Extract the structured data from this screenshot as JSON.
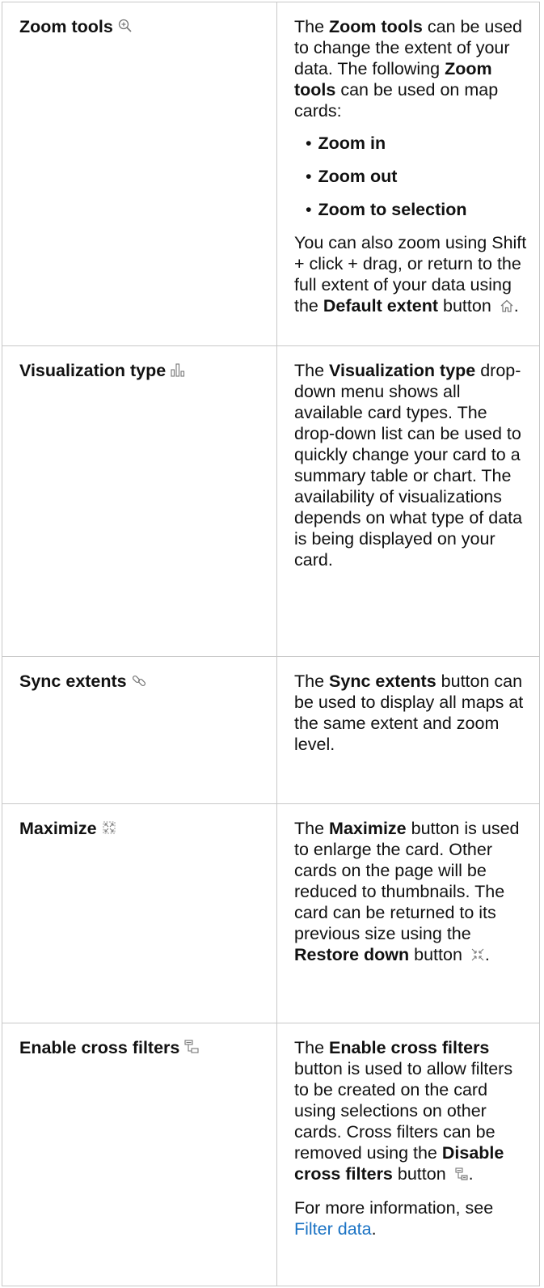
{
  "rows": [
    {
      "tool": "Zoom tools",
      "icon": "zoom-in-icon",
      "desc_intro": [
        "The ",
        "Zoom tools",
        " can be used to change the extent of your data. The following ",
        "Zoom tools",
        " can be used on map cards:"
      ],
      "bullets": [
        "Zoom in",
        "Zoom out",
        "Zoom to selection"
      ],
      "desc_outro": [
        "You can also zoom using Shift + click + drag, or return to the full extent of your data using the ",
        "Default extent",
        " button ",
        "."
      ]
    },
    {
      "tool": "Visualization type",
      "icon": "bar-chart-icon",
      "desc": [
        "The ",
        "Visualization type",
        " drop-down menu shows all available card types. The drop-down list can be used to quickly change your card to a summary table or chart. The availability of visualizations depends on what type of data is being displayed on your card."
      ]
    },
    {
      "tool": "Sync extents",
      "icon": "link-icon",
      "desc": [
        "The ",
        "Sync extents",
        " button can be used to display all maps at the same extent and zoom level."
      ]
    },
    {
      "tool": "Maximize",
      "icon": "maximize-icon",
      "desc": [
        "The ",
        "Maximize",
        " button is used to enlarge the card. Other cards on the page will be reduced to thumbnails. The card can be returned to its previous size using the ",
        "Restore down",
        " button ",
        "."
      ]
    },
    {
      "tool": "Enable cross filters",
      "icon": "cross-filter-icon",
      "desc": [
        "The ",
        "Enable cross filters",
        " button is used to allow filters to be created on the card using selections on other cards. Cross filters can be removed using the ",
        "Disable cross filters",
        " button ",
        "."
      ],
      "more": [
        "For more information, see ",
        "Filter data",
        "."
      ]
    }
  ],
  "colors": {
    "link": "#1b73c4",
    "border": "#c8c8c8",
    "icon": "#777777"
  }
}
